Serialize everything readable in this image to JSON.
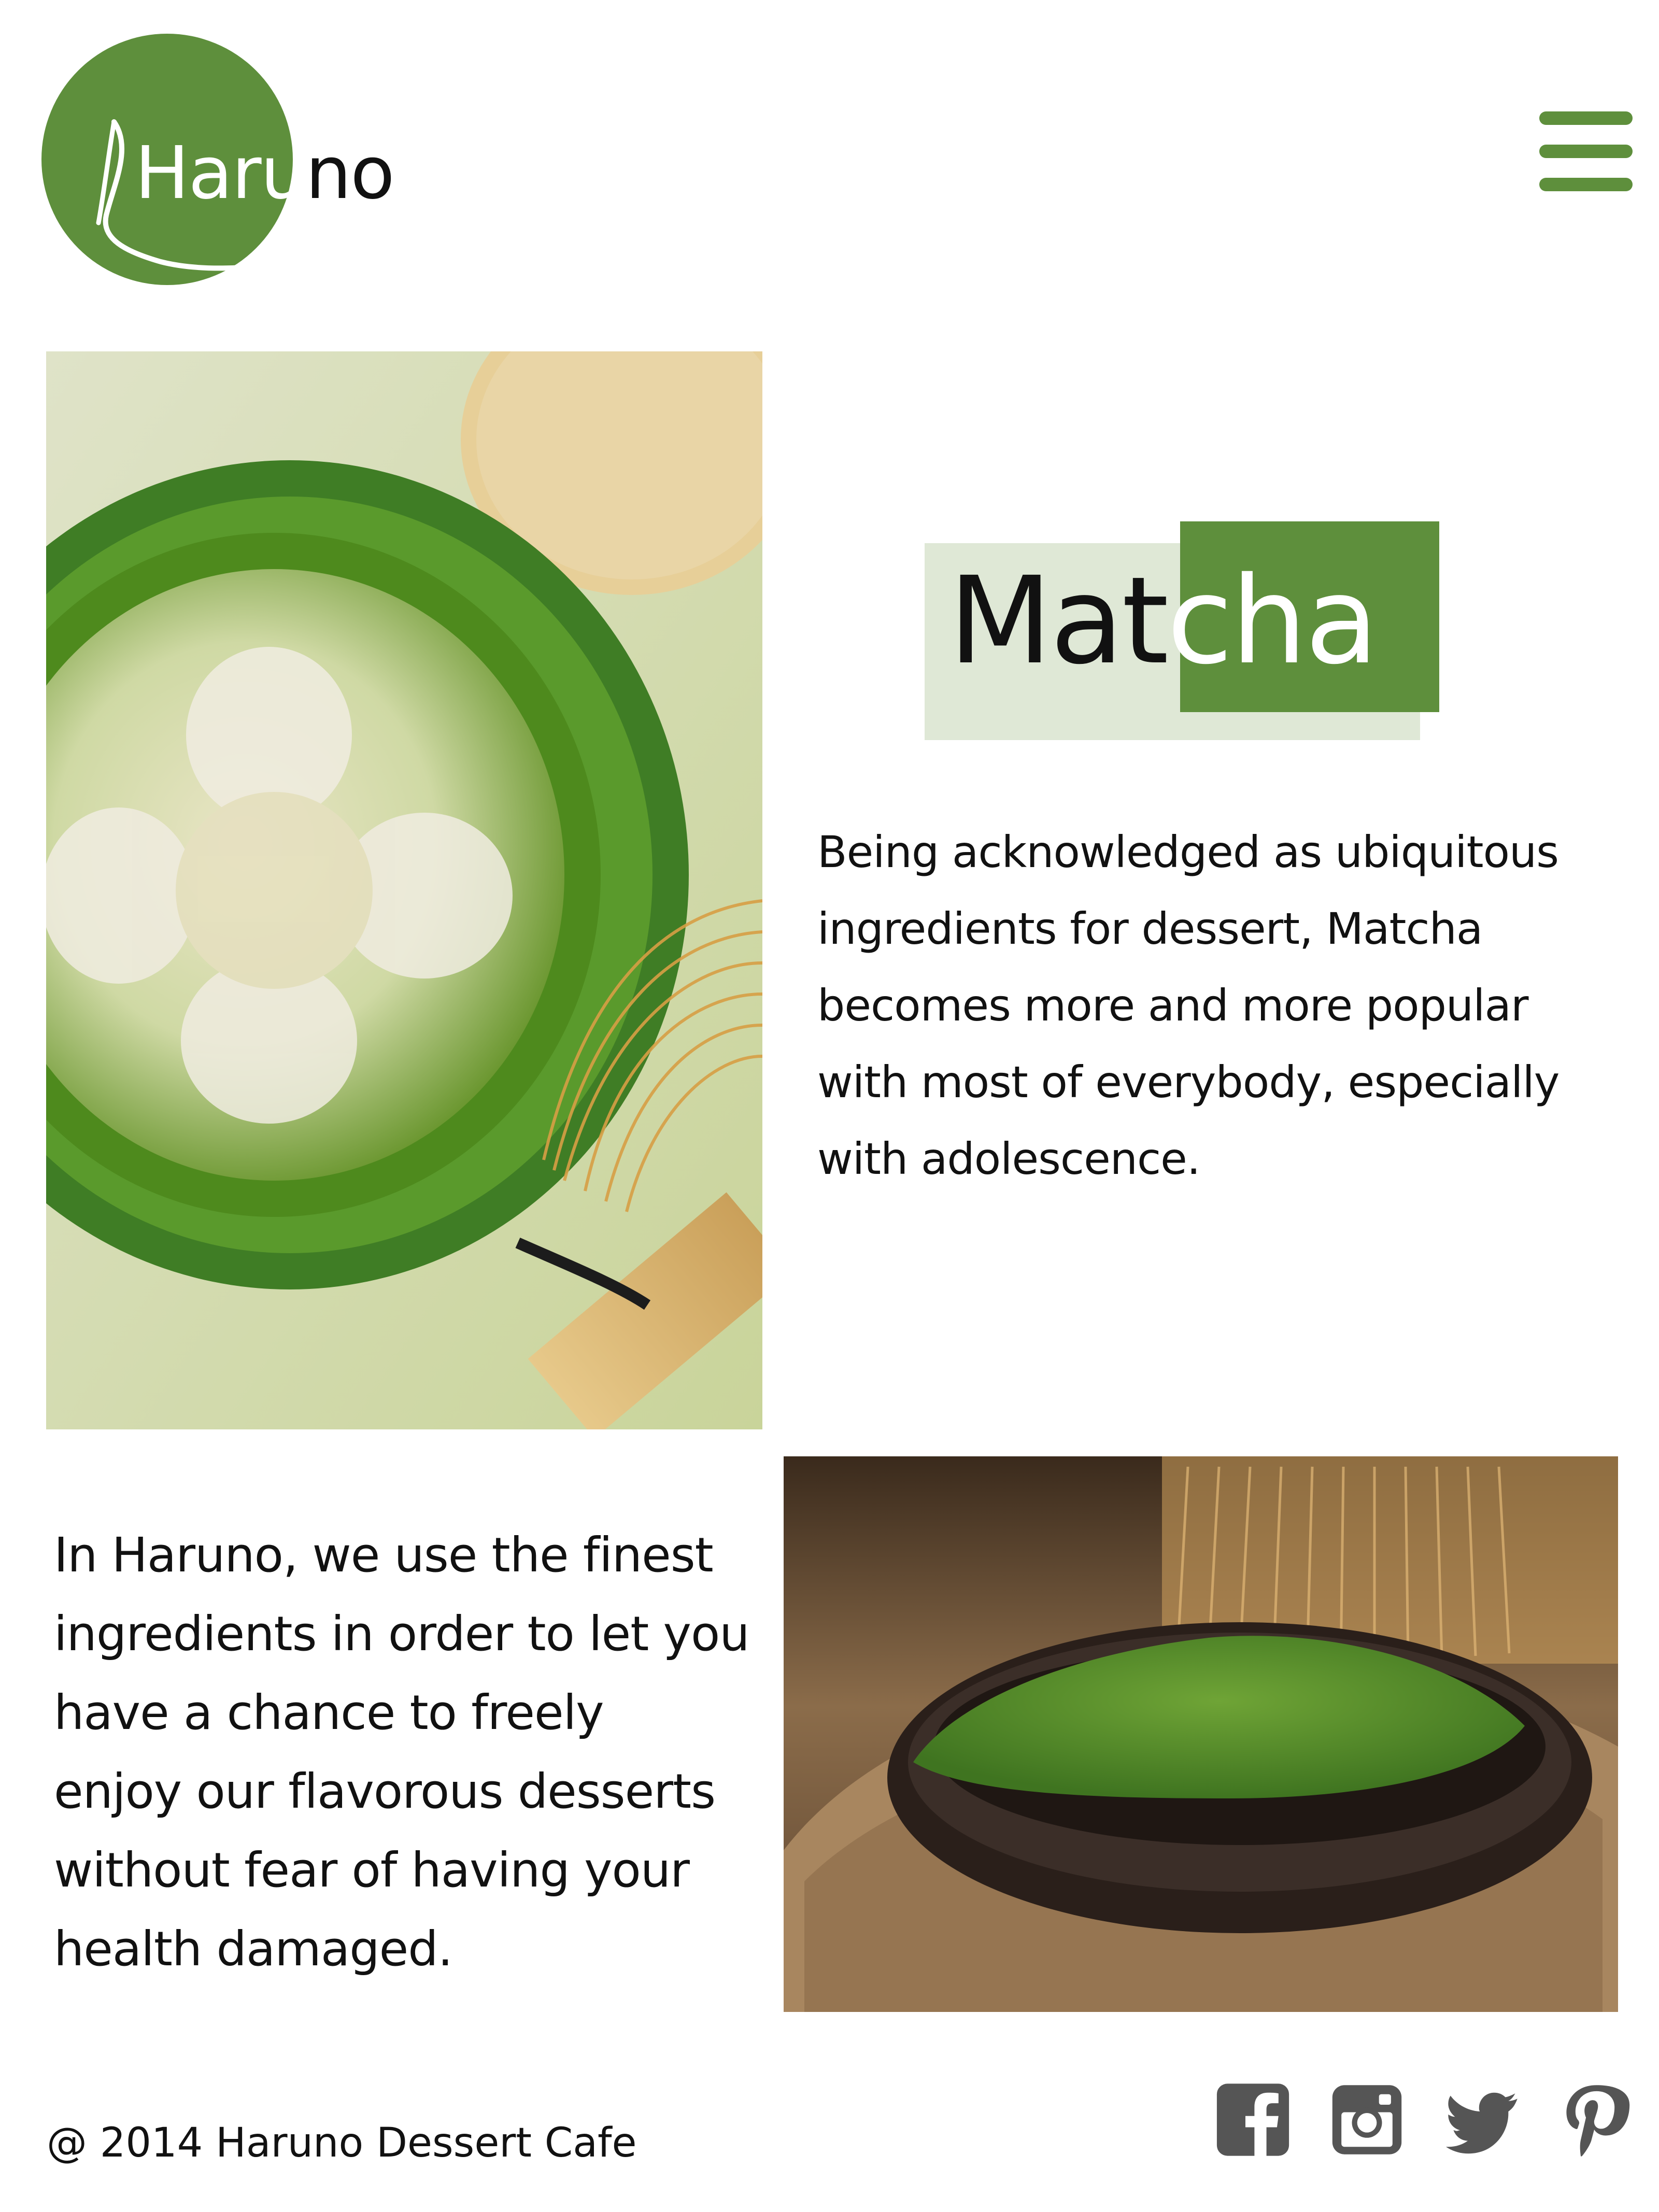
{
  "brand": {
    "logo_text": "Haruno",
    "green": "#5e8f3c",
    "light_green": "#dfe8d6"
  },
  "header": {
    "menu_icon": "hamburger-menu-icon"
  },
  "hero": {
    "image_alt_icon": "matcha-latte-photo",
    "heading_part1": "Mat",
    "heading_part2": "cha",
    "intro": "Being acknowledged as ubiquitous\ningredients for dessert, Matcha\nbecomes more and more popular\nwith most of everybody, especially\nwith adolescence."
  },
  "quality": {
    "image_alt_icon": "matcha-powder-photo",
    "text": "In Haruno, we use the finest\ningredients in order to let you\nhave a chance to freely\nenjoy our flavorous desserts\nwithout fear of having your\nhealth damaged."
  },
  "footer": {
    "copyright": "@ 2014 Haruno Dessert Cafe",
    "social": [
      "facebook-icon",
      "instagram-icon",
      "twitter-icon",
      "pinterest-icon"
    ],
    "icon_color": "#555555"
  }
}
